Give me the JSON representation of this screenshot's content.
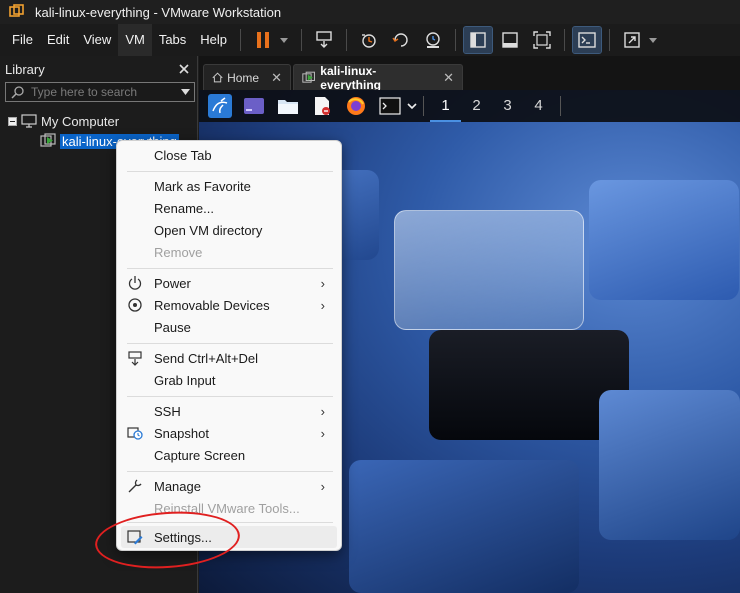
{
  "window": {
    "title": "kali-linux-everything - VMware Workstation"
  },
  "menubar": {
    "items": [
      "File",
      "Edit",
      "View",
      "VM",
      "Tabs",
      "Help"
    ]
  },
  "library": {
    "title": "Library",
    "search_placeholder": "Type here to search",
    "tree": {
      "root": "My Computer",
      "vm": "kali-linux-everything"
    }
  },
  "tabs": [
    {
      "label": "Home"
    },
    {
      "label": "kali-linux-everything"
    }
  ],
  "guest": {
    "workspaces": [
      "1",
      "2",
      "3",
      "4"
    ]
  },
  "context_menu": {
    "close_tab": "Close Tab",
    "mark_favorite": "Mark as Favorite",
    "rename": "Rename...",
    "open_dir": "Open VM directory",
    "remove": "Remove",
    "power": "Power",
    "removable_devices": "Removable Devices",
    "pause": "Pause",
    "send_cad": "Send Ctrl+Alt+Del",
    "grab_input": "Grab Input",
    "ssh": "SSH",
    "snapshot": "Snapshot",
    "capture_screen": "Capture Screen",
    "manage": "Manage",
    "reinstall_tools": "Reinstall VMware Tools...",
    "settings": "Settings..."
  },
  "colors": {
    "accent": "#0a64c8",
    "annotation": "#e02020",
    "pause": "#e8711c"
  }
}
